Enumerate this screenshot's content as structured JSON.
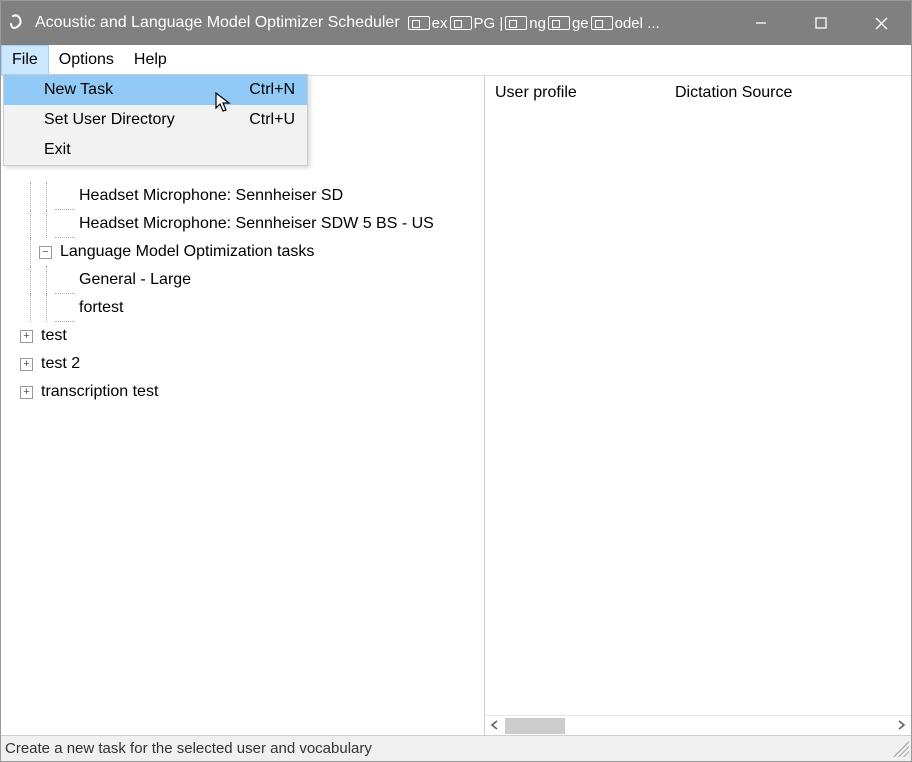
{
  "title": "Acoustic and Language Model Optimizer Scheduler",
  "title_suffix_fragments": [
    "ex",
    "PG |",
    "ng",
    "ge",
    "odel ..."
  ],
  "menubar": {
    "file": "File",
    "options": "Options",
    "help": "Help"
  },
  "dropdown": {
    "new_task": "New Task",
    "new_task_sc": "Ctrl+N",
    "set_dir": "Set User Directory",
    "set_dir_sc": "Ctrl+U",
    "exit": "Exit"
  },
  "tree": {
    "hm_sd": "Headset Microphone: Sennheiser SD",
    "hm_sdw": "Headset Microphone: Sennheiser SDW 5 BS - US",
    "lmot": "Language Model Optimization tasks",
    "gen_large": "General - Large",
    "fortest": "fortest",
    "test": "test",
    "test2": "test 2",
    "trans_test": "transcription test"
  },
  "right": {
    "col1": "User profile",
    "col2": "Dictation Source"
  },
  "status": "Create a new task for the selected user and vocabulary"
}
